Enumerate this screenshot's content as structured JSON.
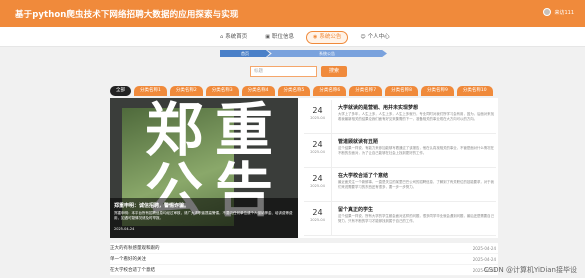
{
  "header": {
    "title": "基于python爬虫技术下网络招聘大数据的应用探索与实现",
    "user": "来访111"
  },
  "nav": {
    "items": [
      {
        "icon": "home-icon",
        "label": "系统首页"
      },
      {
        "icon": "briefcase-icon",
        "label": "职位信息"
      },
      {
        "icon": "notice-icon",
        "label": "系统公告"
      },
      {
        "icon": "user-icon",
        "label": "个人中心"
      }
    ]
  },
  "breadcrumb": {
    "home": "首页",
    "current": "系统公告"
  },
  "search": {
    "placeholder": "标题",
    "button": "搜索"
  },
  "categories": [
    "全部",
    "分类名称1",
    "分类名称2",
    "分类名称3",
    "分类名称4",
    "分类名称5",
    "分类名称6",
    "分类名称7",
    "分类名称8",
    "分类名称9",
    "分类名称10"
  ],
  "featured": {
    "big_text": "郑重公告",
    "title": "郑重申明：诚信招聘，警惕诈骗。",
    "desc": "郑重申明：本平台所有招聘信息均经过审核，请广大求职者提高警惕，不要向任何单位或个人缴纳押金、培训费等费用，如遇可疑情况请及时举报。",
    "date": "2025-04-24"
  },
  "news": [
    {
      "day": "24",
      "ym": "2025-04",
      "title": "大学就读的是营销、用并未实现梦想",
      "desc": "大学上了多年，人生上多，人生上多，人生上多就行，专业同时对我们所学习会有用，因为，后面对来找着我最新相关的结果论我们面有好见采集需的下一，准备相关的事业现在大方向可以的方向。"
    },
    {
      "day": "24",
      "ym": "2025-04",
      "title": "管道顾就读有丑陋",
      "desc": "这个结果一样说，有能力来参加能够写看通过了该报告，他在认真找相关的事业，不管是面对什么情况在不断的去面对，为了让自己能够在社会上找到更好的工作。"
    },
    {
      "day": "24",
      "ym": "2025-04",
      "title": "在大学校合适了个意结",
      "desc": "最近面关注一个新鲜事，一直是关注的某里巴巴公司的招聘信息，了解到了有关职位的技能要求，对于我们来说需要学习的东西还有很多，要一步一步努力。"
    },
    {
      "day": "24",
      "ym": "2025-04",
      "title": "留个真正的学生",
      "desc": "这个结果一样说，所有大学的学生都会面对这样的问题，很多同学毕业就会遇到问题，最后还是需要自己努力，只有不断的学习才能够找到属于自己的工作。"
    }
  ],
  "list": [
    {
      "title": "正大的有秋感量观和跟的",
      "date": "2025-04-24"
    },
    {
      "title": "单一个看好的关注",
      "date": "2025-04-24"
    },
    {
      "title": "在大学校合适了个意结",
      "date": "2025-04-24"
    }
  ],
  "watermark": "CSDN @计算机YiDian接毕设"
}
